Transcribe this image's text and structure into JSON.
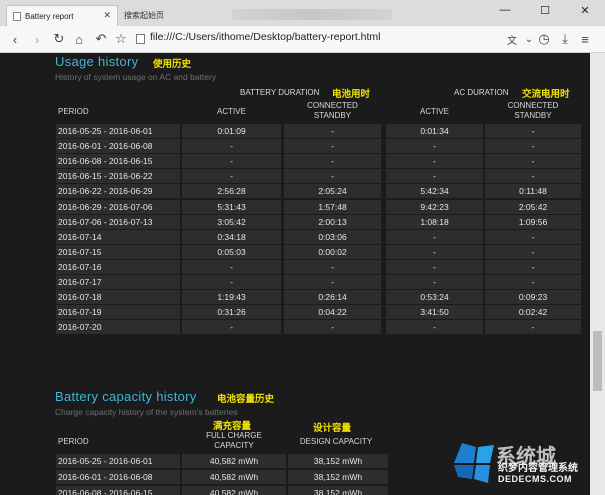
{
  "browser": {
    "active_tab_title": "Battery report",
    "inactive_tab_title": "搜索起始页",
    "url": "file:///C:/Users/ithome/Desktop/battery-report.html"
  },
  "usage": {
    "title": "Usage history",
    "title_cn": "使用历史",
    "subtitle": "History of system usage on AC and battery",
    "battery_duration": "BATTERY DURATION",
    "battery_duration_cn": "电池用时",
    "ac_duration": "AC DURATION",
    "ac_duration_cn": "交流电用时",
    "col_period": "PERIOD",
    "col_active": "ACTIVE",
    "col_connected_standby_1": "CONNECTED",
    "col_connected_standby_2": "STANDBY",
    "rows": [
      {
        "period": "2016-05-25 - 2016-06-01",
        "b_active": "0:01:09",
        "b_standby": "-",
        "ac_active": "0:01:34",
        "ac_standby": "-"
      },
      {
        "period": "2016-06-01 - 2016-06-08",
        "b_active": "-",
        "b_standby": "-",
        "ac_active": "-",
        "ac_standby": "-"
      },
      {
        "period": "2016-06-08 - 2016-06-15",
        "b_active": "-",
        "b_standby": "-",
        "ac_active": "-",
        "ac_standby": "-"
      },
      {
        "period": "2016-06-15 - 2016-06-22",
        "b_active": "-",
        "b_standby": "-",
        "ac_active": "-",
        "ac_standby": "-"
      },
      {
        "period": "2016-06-22 - 2016-06-29",
        "b_active": "2:56:28",
        "b_standby": "2:05:24",
        "ac_active": "5:42:34",
        "ac_standby": "0:11:48"
      },
      {
        "period": "2016-06-29 - 2016-07-06",
        "b_active": "5:31:43",
        "b_standby": "1:57:48",
        "ac_active": "9:42:23",
        "ac_standby": "2:05:42"
      },
      {
        "period": "2016-07-06 - 2016-07-13",
        "b_active": "3:05:42",
        "b_standby": "2:00:13",
        "ac_active": "1:08:18",
        "ac_standby": "1:09:56"
      },
      {
        "period": "2016-07-14",
        "b_active": "0:34:18",
        "b_standby": "0:03:06",
        "ac_active": "-",
        "ac_standby": "-"
      },
      {
        "period": "2016-07-15",
        "b_active": "0:05:03",
        "b_standby": "0:00:02",
        "ac_active": "-",
        "ac_standby": "-"
      },
      {
        "period": "2016-07-16",
        "b_active": "-",
        "b_standby": "-",
        "ac_active": "-",
        "ac_standby": "-"
      },
      {
        "period": "2016-07-17",
        "b_active": "-",
        "b_standby": "-",
        "ac_active": "-",
        "ac_standby": "-"
      },
      {
        "period": "2016-07-18",
        "b_active": "1:19:43",
        "b_standby": "0:26:14",
        "ac_active": "0:53:24",
        "ac_standby": "0:09:23"
      },
      {
        "period": "2016-07-19",
        "b_active": "0:31:26",
        "b_standby": "0:04:22",
        "ac_active": "3:41:50",
        "ac_standby": "0:02:42"
      },
      {
        "period": "2016-07-20",
        "b_active": "-",
        "b_standby": "-",
        "ac_active": "-",
        "ac_standby": "-"
      }
    ]
  },
  "capacity": {
    "title": "Battery capacity history",
    "title_cn": "电池容量历史",
    "subtitle": "Charge capacity history of the system's batteries",
    "col_period": "PERIOD",
    "full_cn": "满充容量",
    "full_1": "FULL CHARGE",
    "full_2": "CAPACITY",
    "design_cn": "设计容量",
    "design": "DESIGN CAPACITY",
    "rows": [
      {
        "period": "2016-05-25 - 2016-06-01",
        "full": "40,582 mWh",
        "design": "38,152 mWh"
      },
      {
        "period": "2016-06-01 - 2016-06-08",
        "full": "40,582 mWh",
        "design": "38,152 mWh"
      },
      {
        "period": "2016-06-08 - 2016-06-15",
        "full": "40,582 mWh",
        "design": "38,152 mWh"
      }
    ]
  },
  "watermark": {
    "brand_cn": "系统城",
    "domain": "DEDECMS.COM",
    "tagline_cn": "织梦内容管理系统"
  },
  "colors": {
    "accent": "#3fb6d9",
    "highlight": "#f2e200",
    "cell_bg": "#2d2d2d",
    "page_bg": "#1b1b1b"
  }
}
